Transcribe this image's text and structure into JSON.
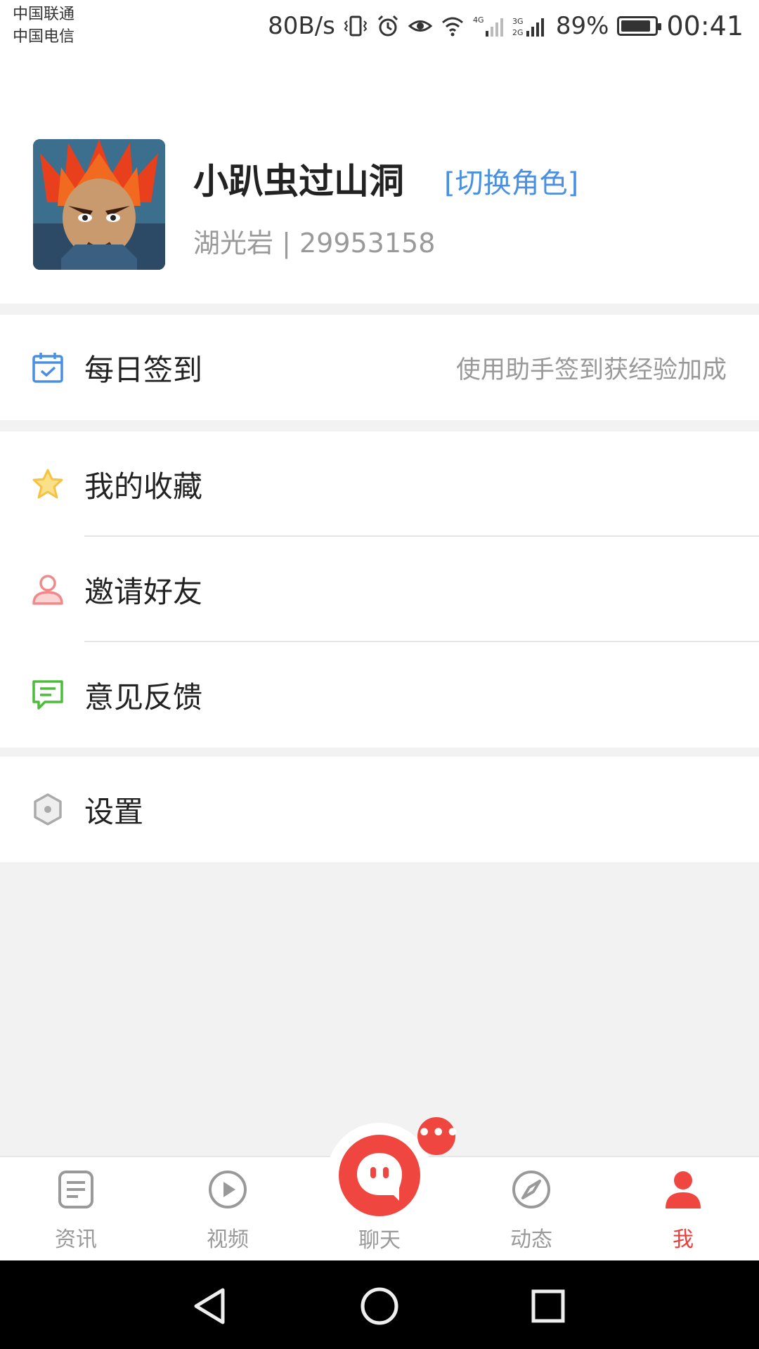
{
  "status_bar": {
    "carrier_1": "中国联通",
    "carrier_2": "中国电信",
    "net_speed": "80B/s",
    "battery_pct": "89%",
    "battery_level": 0.89,
    "time": "00:41",
    "icons": [
      "vibrate-icon",
      "alarm-icon",
      "eye-icon",
      "wifi-icon",
      "signal-4g-icon",
      "signal-3g-2g-icon",
      "battery-icon"
    ]
  },
  "profile": {
    "name": "小趴虫过山洞",
    "switch_role": "[切换角色]",
    "sub_info": "湖光岩 | 29953158"
  },
  "sections": {
    "checkin": {
      "label": "每日签到",
      "hint": "使用助手签到获经验加成",
      "icon": "calendar-check-icon",
      "icon_color": "#4a90e2"
    },
    "favorites": {
      "label": "我的收藏",
      "icon": "star-icon",
      "icon_color": "#f5c242"
    },
    "invite": {
      "label": "邀请好友",
      "icon": "user-icon",
      "icon_color": "#f08a8a"
    },
    "feedback": {
      "label": "意见反馈",
      "icon": "message-icon",
      "icon_color": "#4cbd3a"
    },
    "settings": {
      "label": "设置",
      "icon": "hexagon-settings-icon",
      "icon_color": "#aaaaaa"
    }
  },
  "tab_bar": {
    "tabs": [
      {
        "label": "资讯",
        "icon": "news-icon",
        "active": false
      },
      {
        "label": "视频",
        "icon": "play-icon",
        "active": false
      },
      {
        "label": "聊天",
        "icon": "chat-icon",
        "active": false
      },
      {
        "label": "动态",
        "icon": "compass-icon",
        "active": false
      },
      {
        "label": "我",
        "icon": "person-icon",
        "active": true
      }
    ],
    "chat_badge": "•••",
    "accent": "#e8413c"
  },
  "nav_bar": {
    "icons": [
      "back-icon",
      "home-icon",
      "recents-icon"
    ]
  }
}
